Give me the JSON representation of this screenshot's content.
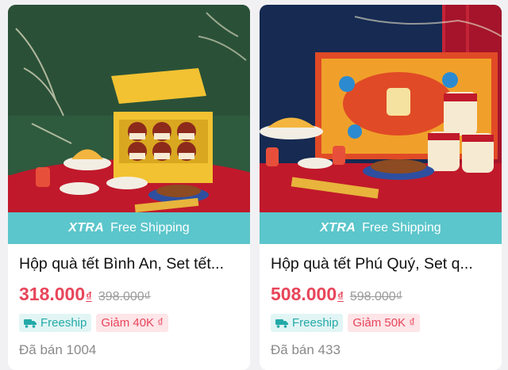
{
  "products": [
    {
      "banner": {
        "brand": "XTRA",
        "text": "Free Shipping"
      },
      "title": "Hộp quà tết Bình An, Set tết...",
      "price": "318.000",
      "currency": "₫",
      "old_price": "398.000₫",
      "tags": {
        "freeship": "Freeship",
        "discount": "Giảm 40K ₫"
      },
      "sold": "Đã bán 1004",
      "image": {
        "box_color": "#f2c232",
        "background": "#2e5a3e",
        "table": "#c0192b"
      }
    },
    {
      "banner": {
        "brand": "XTRA",
        "text": "Free Shipping"
      },
      "title": "Hộp quà tết Phú Quý, Set q...",
      "price": "508.000",
      "currency": "₫",
      "old_price": "598.000₫",
      "tags": {
        "freeship": "Freeship",
        "discount": "Giảm 50K ₫"
      },
      "sold": "Đã bán 433",
      "image": {
        "box_color": "#e04a26",
        "background": "#162a52",
        "table": "#c0192b"
      }
    }
  ],
  "colors": {
    "accent": "#e8455a",
    "banner": "#5bc6cb",
    "freeship": "#23aaa8"
  },
  "icons": {
    "freeship": "delivery-truck-icon"
  }
}
